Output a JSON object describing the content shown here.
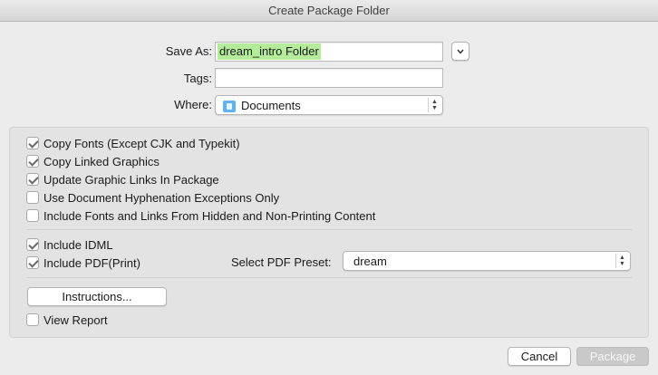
{
  "window": {
    "title": "Create Package Folder"
  },
  "form": {
    "save_as_label": "Save As:",
    "save_as_value": "dream_intro Folder",
    "tags_label": "Tags:",
    "tags_value": "",
    "where_label": "Where:",
    "where_value": "Documents"
  },
  "options": {
    "copy_fonts": {
      "label": "Copy Fonts (Except CJK and Typekit)",
      "checked": true
    },
    "copy_graphics": {
      "label": "Copy Linked Graphics",
      "checked": true
    },
    "update_links": {
      "label": "Update Graphic Links In Package",
      "checked": true
    },
    "hyphenation": {
      "label": "Use Document Hyphenation Exceptions Only",
      "checked": false
    },
    "hidden_content": {
      "label": "Include Fonts and Links From Hidden and Non-Printing Content",
      "checked": false
    },
    "include_idml": {
      "label": "Include IDML",
      "checked": true
    },
    "include_pdf": {
      "label": "Include PDF(Print)",
      "checked": true
    },
    "view_report": {
      "label": "View Report",
      "checked": false
    }
  },
  "pdf_preset": {
    "label": "Select PDF Preset:",
    "value": "dream"
  },
  "buttons": {
    "instructions": "Instructions...",
    "cancel": "Cancel",
    "package": "Package"
  },
  "icons": {
    "expand": "chevron-down-icon",
    "folder": "documents-folder-icon",
    "stepper": "up-down-stepper-icon"
  },
  "colors": {
    "selection_highlight": "#b5ec9a",
    "folder_blue": "#5fb4f0"
  }
}
